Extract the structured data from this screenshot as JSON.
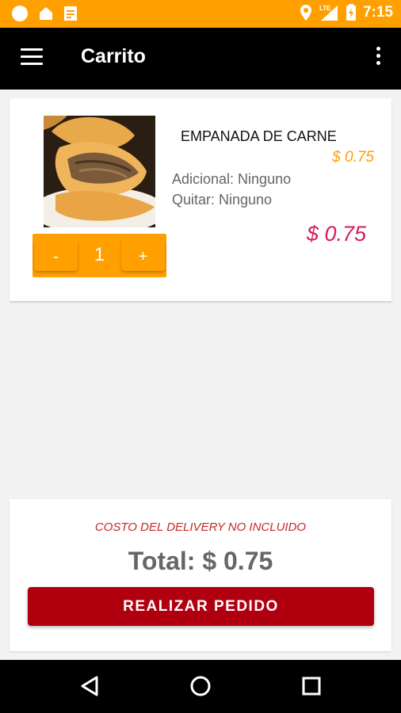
{
  "status_bar": {
    "time": "7:15",
    "network": "LTE",
    "icons": [
      "circle-notification-icon",
      "home-notification-icon",
      "note-notification-icon",
      "location-icon",
      "signal-icon",
      "battery-charging-icon"
    ]
  },
  "app_bar": {
    "title": "Carrito",
    "icons": [
      "menu-icon",
      "more-vert-icon"
    ]
  },
  "cart": {
    "items": [
      {
        "name": "EMPANADA DE CARNE",
        "unit_price": "$ 0.75",
        "additional": "Adicional: Ninguno",
        "remove": "Quitar: Ninguno",
        "line_total": "$ 0.75",
        "quantity": "1",
        "minus_label": "-",
        "plus_label": "+"
      }
    ]
  },
  "summary": {
    "delivery_note": "COSTO DEL DELIVERY NO INCLUIDO",
    "total": "Total: $ 0.75",
    "order_button": "REALIZAR PEDIDO"
  },
  "nav_bar": {
    "icons": [
      "back-icon",
      "home-icon",
      "recents-icon"
    ]
  },
  "colors": {
    "accent": "#ffa000",
    "app_bar": "#000000",
    "price_highlight": "#d81b60",
    "order_button": "#b00010",
    "delivery_note": "#c62828"
  }
}
